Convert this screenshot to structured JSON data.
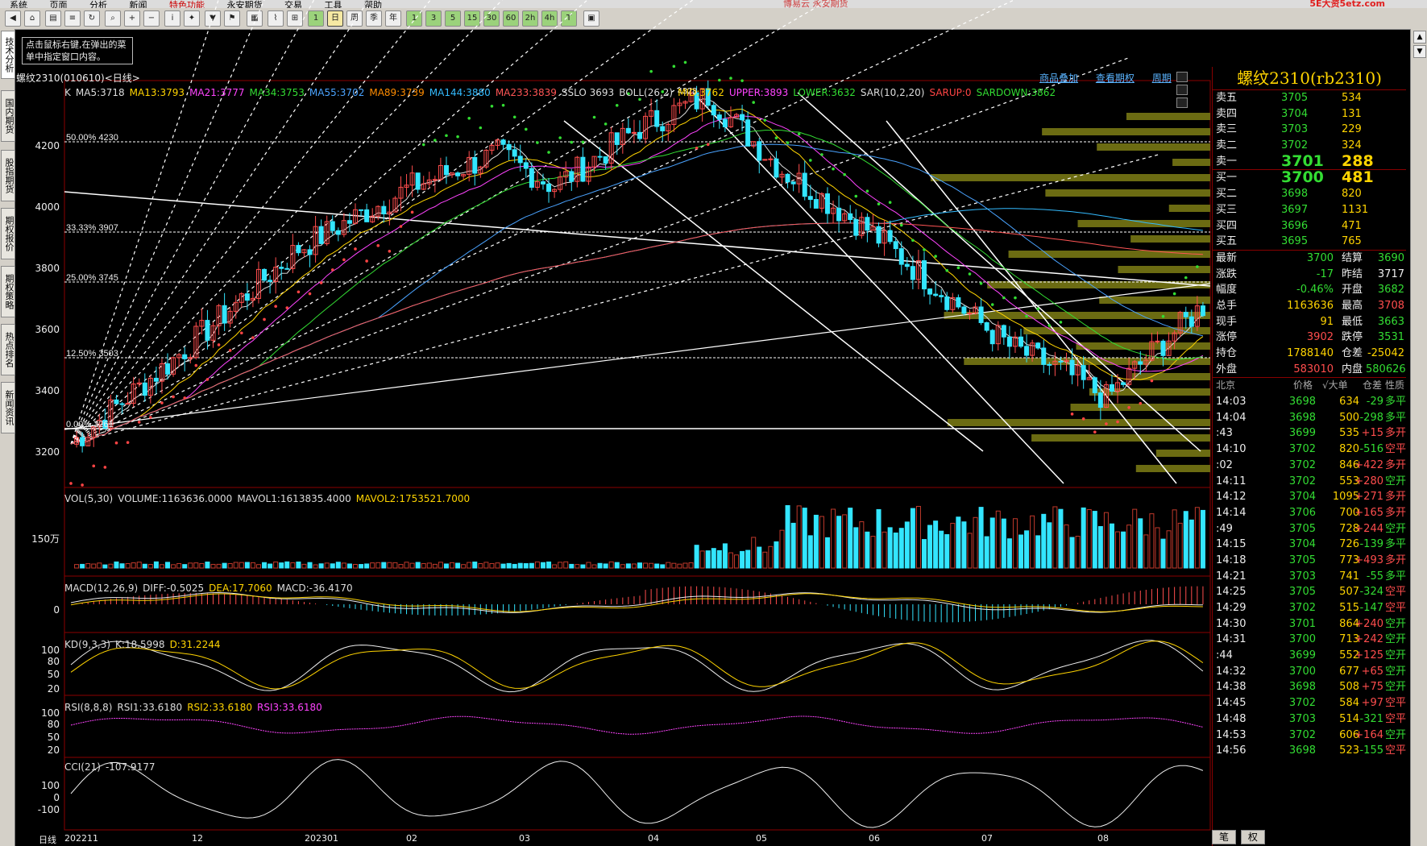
{
  "menubar": {
    "items": [
      "系统",
      "页面",
      "分析",
      "新闻",
      "特色功能",
      "永安期货",
      "交易",
      "工具",
      "帮助"
    ],
    "brand": "博易云 永安期货",
    "logo": "5E大资5etz.com"
  },
  "toolbar": {
    "labels": [
      "1",
      "3",
      "5",
      "15",
      "30",
      "60",
      "日",
      "周",
      "季",
      "年",
      "2h",
      "4h"
    ]
  },
  "sidetabs": [
    "技术分析",
    "国内期货",
    "股指期货",
    "期权报价",
    "期权策略",
    "热点排名",
    "新闻资讯"
  ],
  "hint": "点击鼠标右键,在弹出的菜单中指定窗口内容。",
  "chart_title": "螺纹2310(010610)<日线>",
  "top_links": [
    "商品叠加",
    "查看期权",
    "周期"
  ],
  "ma_line": [
    {
      "t": "K",
      "c": "#dddddd"
    },
    {
      "t": "MA5:3718",
      "c": "#dddddd"
    },
    {
      "t": "MA13:3793",
      "c": "#ffd400"
    },
    {
      "t": "MA21:3777",
      "c": "#ff44ff"
    },
    {
      "t": "MA34:3753",
      "c": "#33dd33"
    },
    {
      "t": "MA55:3702",
      "c": "#4aa3ff"
    },
    {
      "t": "MA89:3739",
      "c": "#ff8c00"
    },
    {
      "t": "MA144:3880",
      "c": "#33bbff"
    },
    {
      "t": "MA233:3839",
      "c": "#ff5555"
    },
    {
      "t": "SSLO 3693",
      "c": "#dddddd"
    },
    {
      "t": "BOLL(26,2)",
      "c": "#dddddd"
    },
    {
      "t": "MID:3762",
      "c": "#ffd400"
    },
    {
      "t": "UPPER:3893",
      "c": "#ff44ff"
    },
    {
      "t": "LOWER:3632",
      "c": "#33dd33"
    },
    {
      "t": "SAR(10,2,20)",
      "c": "#dddddd"
    },
    {
      "t": "SARUP:0",
      "c": "#ff4444"
    },
    {
      "t": "SARDOWN:3862",
      "c": "#33dd33"
    }
  ],
  "price_axis": [
    "4200",
    "4000",
    "3800",
    "3600",
    "3400",
    "3200"
  ],
  "fib": [
    "50.00%  4230",
    "33.33%  3907",
    "25.00%  3745",
    "12.50%  3503",
    "0.00%  3261"
  ],
  "peak_label": "4328",
  "vol_line": [
    {
      "t": "VOL(5,30)",
      "c": "#dddddd"
    },
    {
      "t": "VOLUME:1163636.0000",
      "c": "#dddddd"
    },
    {
      "t": "MAVOL1:1613835.4000",
      "c": "#dddddd"
    },
    {
      "t": "MAVOL2:1753521.7000",
      "c": "#ffd400"
    }
  ],
  "vol_axis": "150万",
  "macd_line": [
    {
      "t": "MACD(12,26,9)",
      "c": "#dddddd"
    },
    {
      "t": "DIFF:-0.5025",
      "c": "#dddddd"
    },
    {
      "t": "DEA:17.7060",
      "c": "#ffd400"
    },
    {
      "t": "MACD:-36.4170",
      "c": "#dddddd"
    }
  ],
  "macd_axis": "0",
  "kd_line": [
    {
      "t": "KD(9,3,3)",
      "c": "#dddddd"
    },
    {
      "t": "K:18.5998",
      "c": "#dddddd"
    },
    {
      "t": "D:31.2244",
      "c": "#ffd400"
    }
  ],
  "kd_axis": [
    "100",
    "80",
    "50",
    "20"
  ],
  "rsi_line": [
    {
      "t": "RSI(8,8,8)",
      "c": "#dddddd"
    },
    {
      "t": "RSI1:33.6180",
      "c": "#dddddd"
    },
    {
      "t": "RSI2:33.6180",
      "c": "#ffd400"
    },
    {
      "t": "RSI3:33.6180",
      "c": "#ff44ff"
    }
  ],
  "rsi_axis": [
    "100",
    "80",
    "50",
    "20"
  ],
  "cci_line": [
    {
      "t": "CCI(21)",
      "c": "#dddddd"
    },
    {
      "t": "-107.9177",
      "c": "#dddddd"
    }
  ],
  "cci_axis": [
    "100",
    "0",
    "-100"
  ],
  "x_axis": [
    "日线",
    "202211",
    "12",
    "202301",
    "02",
    "03",
    "04",
    "05",
    "06",
    "07",
    "08"
  ],
  "quote": {
    "title": "螺纹2310(rb2310)",
    "asks": [
      {
        "l": "卖五",
        "p": "3705",
        "v": "534"
      },
      {
        "l": "卖四",
        "p": "3704",
        "v": "131"
      },
      {
        "l": "卖三",
        "p": "3703",
        "v": "229"
      },
      {
        "l": "卖二",
        "p": "3702",
        "v": "324"
      },
      {
        "l": "卖一",
        "p": "3701",
        "v": "288"
      }
    ],
    "bids": [
      {
        "l": "买一",
        "p": "3700",
        "v": "481"
      },
      {
        "l": "买二",
        "p": "3698",
        "v": "820"
      },
      {
        "l": "买三",
        "p": "3697",
        "v": "1131"
      },
      {
        "l": "买四",
        "p": "3696",
        "v": "471"
      },
      {
        "l": "买五",
        "p": "3695",
        "v": "765"
      }
    ],
    "stats": [
      {
        "a": "最新",
        "b": "3700",
        "bc": "#33dd33",
        "c": "结算",
        "d": "3690",
        "dc": "#33dd33"
      },
      {
        "a": "涨跌",
        "b": "-17",
        "bc": "#33dd33",
        "c": "昨结",
        "d": "3717",
        "dc": "#eeeeee"
      },
      {
        "a": "幅度",
        "b": "-0.46%",
        "bc": "#33dd33",
        "c": "开盘",
        "d": "3682",
        "dc": "#33dd33"
      },
      {
        "a": "总手",
        "b": "1163636",
        "bc": "#ffd400",
        "c": "最高",
        "d": "3708",
        "dc": "#ff4d4d"
      },
      {
        "a": "现手",
        "b": "91",
        "bc": "#ffd400",
        "c": "最低",
        "d": "3663",
        "dc": "#33dd33"
      },
      {
        "a": "涨停",
        "b": "3902",
        "bc": "#ff4d4d",
        "c": "跌停",
        "d": "3531",
        "dc": "#33dd33"
      },
      {
        "a": "持仓",
        "b": "1788140",
        "bc": "#ffd400",
        "c": "仓差",
        "d": "-25042",
        "dc": "#ffd400"
      },
      {
        "a": "外盘",
        "b": "583010",
        "bc": "#ff4d4d",
        "c": "内盘",
        "d": "580626",
        "dc": "#33dd33"
      }
    ],
    "tick_head": [
      "北京",
      "价格",
      "√大单",
      "仓差",
      "性质"
    ],
    "ticks": [
      {
        "t": "14:03",
        "p": "3698",
        "v": "634",
        "c": "-29",
        "n": "多平",
        "nc": "#33dd33"
      },
      {
        "t": "14:04",
        "p": "3698",
        "v": "500",
        "c": "-298",
        "n": "多平",
        "nc": "#33dd33"
      },
      {
        "t": ":43",
        "p": "3699",
        "v": "535",
        "c": "+15",
        "n": "多开",
        "nc": "#ff4d4d"
      },
      {
        "t": "14:10",
        "p": "3702",
        "v": "820",
        "c": "-516",
        "n": "空平",
        "nc": "#ff4d4d"
      },
      {
        "t": ":02",
        "p": "3702",
        "v": "846",
        "c": "+422",
        "n": "多开",
        "nc": "#ff4d4d"
      },
      {
        "t": "14:11",
        "p": "3702",
        "v": "553",
        "c": "+280",
        "n": "空开",
        "nc": "#33dd33"
      },
      {
        "t": "14:12",
        "p": "3704",
        "v": "1095",
        "c": "+271",
        "n": "多开",
        "nc": "#ff4d4d"
      },
      {
        "t": "14:14",
        "p": "3706",
        "v": "700",
        "c": "+165",
        "n": "多开",
        "nc": "#ff4d4d"
      },
      {
        "t": ":49",
        "p": "3705",
        "v": "728",
        "c": "+244",
        "n": "空开",
        "nc": "#33dd33"
      },
      {
        "t": "14:15",
        "p": "3704",
        "v": "726",
        "c": "-139",
        "n": "多平",
        "nc": "#33dd33"
      },
      {
        "t": "14:18",
        "p": "3705",
        "v": "773",
        "c": "+493",
        "n": "多开",
        "nc": "#ff4d4d"
      },
      {
        "t": "14:21",
        "p": "3703",
        "v": "741",
        "c": "-55",
        "n": "多平",
        "nc": "#33dd33"
      },
      {
        "t": "14:25",
        "p": "3705",
        "v": "507",
        "c": "-324",
        "n": "空平",
        "nc": "#ff4d4d"
      },
      {
        "t": "14:29",
        "p": "3702",
        "v": "515",
        "c": "-147",
        "n": "空平",
        "nc": "#ff4d4d"
      },
      {
        "t": "14:30",
        "p": "3701",
        "v": "864",
        "c": "+240",
        "n": "空开",
        "nc": "#33dd33"
      },
      {
        "t": "14:31",
        "p": "3700",
        "v": "713",
        "c": "+242",
        "n": "空开",
        "nc": "#33dd33"
      },
      {
        "t": ":44",
        "p": "3699",
        "v": "552",
        "c": "+125",
        "n": "空开",
        "nc": "#33dd33"
      },
      {
        "t": "14:32",
        "p": "3700",
        "v": "677",
        "c": "+65",
        "n": "空开",
        "nc": "#33dd33"
      },
      {
        "t": "14:38",
        "p": "3698",
        "v": "508",
        "c": "+75",
        "n": "空开",
        "nc": "#33dd33"
      },
      {
        "t": "14:45",
        "p": "3702",
        "v": "584",
        "c": "+97",
        "n": "空平",
        "nc": "#ff4d4d"
      },
      {
        "t": "14:48",
        "p": "3703",
        "v": "514",
        "c": "-321",
        "n": "空平",
        "nc": "#ff4d4d"
      },
      {
        "t": "14:53",
        "p": "3702",
        "v": "606",
        "c": "+164",
        "n": "空开",
        "nc": "#33dd33"
      },
      {
        "t": "14:56",
        "p": "3698",
        "v": "523",
        "c": "-155",
        "n": "空平",
        "nc": "#ff4d4d"
      }
    ],
    "tabs": [
      "笔",
      "权"
    ]
  },
  "colors": {
    "up": "#ff4d4d",
    "down": "#33e5ff",
    "up_vol": "#c0392b",
    "ma5": "#dddddd",
    "ma13": "#ffd400",
    "ma21": "#ff44ff",
    "ma34": "#33dd33",
    "ma55": "#4aa3ff",
    "ma144": "#33bbff",
    "ma233": "#ff5555",
    "olive": "#6b6b12"
  }
}
